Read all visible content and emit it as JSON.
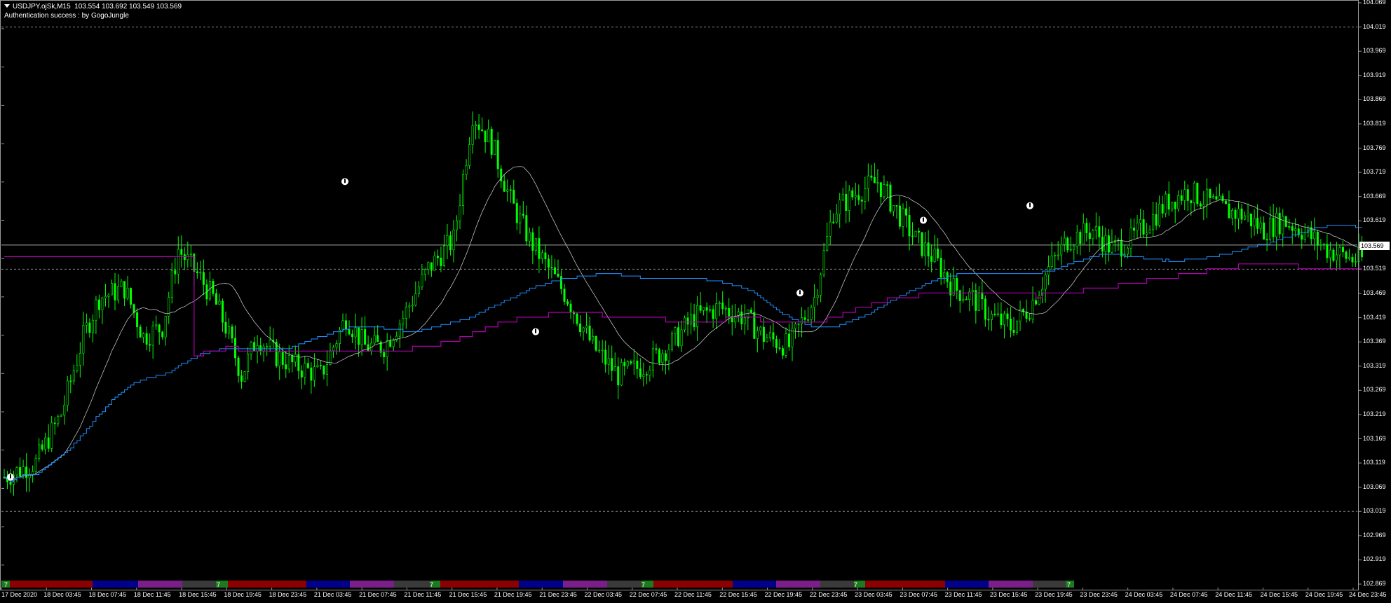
{
  "header": {
    "symbol_line": "USDJPY.ojSk,M15  103.554 103.692 103.549 103.569",
    "auth_line": "Authentication success : by GogoJungle"
  },
  "price_axis": {
    "ticks": [
      "104.069",
      "104.019",
      "103.969",
      "103.919",
      "103.869",
      "103.819",
      "103.769",
      "103.719",
      "103.669",
      "103.619",
      "103.569",
      "103.519",
      "103.469",
      "103.419",
      "103.369",
      "103.319",
      "103.269",
      "103.219",
      "103.169",
      "103.119",
      "103.069",
      "103.019",
      "102.969",
      "102.919",
      "102.869"
    ],
    "current_price": "103.569"
  },
  "time_axis": {
    "ticks": [
      "17 Dec 2020",
      "18 Dec 03:45",
      "18 Dec 07:45",
      "18 Dec 11:45",
      "18 Dec 15:45",
      "18 Dec 19:45",
      "18 Dec 23:45",
      "21 Dec 03:45",
      "21 Dec 07:45",
      "21 Dec 11:45",
      "21 Dec 15:45",
      "21 Dec 19:45",
      "21 Dec 23:45",
      "22 Dec 03:45",
      "22 Dec 07:45",
      "22 Dec 11:45",
      "22 Dec 15:45",
      "22 Dec 19:45",
      "22 Dec 23:45",
      "23 Dec 03:45",
      "23 Dec 07:45",
      "23 Dec 11:45",
      "23 Dec 15:45",
      "23 Dec 19:45",
      "23 Dec 23:45",
      "24 Dec 03:45",
      "24 Dec 07:45",
      "24 Dec 11:45",
      "24 Dec 15:45",
      "24 Dec 19:45",
      "24 Dec 23:45"
    ]
  },
  "session_bar": {
    "marker_text": "7",
    "colors": {
      "green": "#1e7a1e",
      "red": "#8b0000",
      "blue": "#00008b",
      "purple": "#7a1f8a",
      "gray": "#3a3a3a"
    }
  },
  "chart_data": {
    "type": "candlestick",
    "symbol": "USDJPY.ojSk",
    "timeframe": "M15",
    "ohlc_last": {
      "open": 103.554,
      "high": 103.692,
      "low": 103.549,
      "close": 103.569
    },
    "ylim": [
      102.869,
      104.069
    ],
    "grid": false,
    "candle_color": "#00ff00",
    "indicator_colors": {
      "fast_ma": "#c0c0c0",
      "slow_ma": "#1e90ff",
      "long_ma": "#b000b0"
    },
    "price_path": [
      [
        0,
        103.09
      ],
      [
        10,
        103.12
      ],
      [
        18,
        103.22
      ],
      [
        25,
        103.38
      ],
      [
        30,
        103.46
      ],
      [
        38,
        103.48
      ],
      [
        44,
        103.38
      ],
      [
        50,
        103.4
      ],
      [
        55,
        103.56
      ],
      [
        62,
        103.5
      ],
      [
        66,
        103.46
      ],
      [
        70,
        103.4
      ],
      [
        75,
        103.3
      ],
      [
        80,
        103.38
      ],
      [
        86,
        103.34
      ],
      [
        92,
        103.32
      ],
      [
        100,
        103.3
      ],
      [
        108,
        103.42
      ],
      [
        114,
        103.36
      ],
      [
        120,
        103.36
      ],
      [
        126,
        103.42
      ],
      [
        134,
        103.52
      ],
      [
        142,
        103.58
      ],
      [
        148,
        103.84
      ],
      [
        154,
        103.78
      ],
      [
        160,
        103.66
      ],
      [
        166,
        103.58
      ],
      [
        172,
        103.52
      ],
      [
        178,
        103.46
      ],
      [
        186,
        103.36
      ],
      [
        194,
        103.3
      ],
      [
        202,
        103.32
      ],
      [
        210,
        103.36
      ],
      [
        218,
        103.42
      ],
      [
        226,
        103.44
      ],
      [
        234,
        103.42
      ],
      [
        240,
        103.38
      ],
      [
        248,
        103.36
      ],
      [
        256,
        103.46
      ],
      [
        262,
        103.64
      ],
      [
        270,
        103.68
      ],
      [
        276,
        103.7
      ],
      [
        282,
        103.64
      ],
      [
        288,
        103.58
      ],
      [
        294,
        103.54
      ],
      [
        300,
        103.48
      ],
      [
        306,
        103.46
      ],
      [
        312,
        103.42
      ],
      [
        318,
        103.4
      ],
      [
        324,
        103.44
      ],
      [
        330,
        103.52
      ],
      [
        336,
        103.58
      ],
      [
        344,
        103.6
      ],
      [
        350,
        103.56
      ],
      [
        356,
        103.58
      ],
      [
        362,
        103.62
      ],
      [
        368,
        103.66
      ],
      [
        374,
        103.68
      ],
      [
        380,
        103.66
      ],
      [
        386,
        103.64
      ],
      [
        392,
        103.63
      ],
      [
        398,
        103.6
      ],
      [
        404,
        103.62
      ],
      [
        410,
        103.6
      ],
      [
        418,
        103.56
      ],
      [
        426,
        103.54
      ]
    ],
    "session_ranges": [
      [
        [
          0,
          12
        ],
        "green"
      ],
      [
        [
          12,
          130
        ],
        "red"
      ],
      [
        [
          130,
          195
        ],
        "blue"
      ],
      [
        [
          195,
          258
        ],
        "purple"
      ],
      [
        [
          258,
          306
        ],
        "gray"
      ],
      [
        [
          306,
          323
        ],
        "green"
      ],
      [
        [
          323,
          435
        ],
        "red"
      ],
      [
        [
          435,
          497
        ],
        "blue"
      ],
      [
        [
          497,
          560
        ],
        "purple"
      ],
      [
        [
          560,
          612
        ],
        "gray"
      ],
      [
        [
          612,
          626
        ],
        "green"
      ],
      [
        [
          626,
          738
        ],
        "red"
      ],
      [
        [
          738,
          801
        ],
        "blue"
      ],
      [
        [
          801,
          864
        ],
        "purple"
      ],
      [
        [
          864,
          913
        ],
        "gray"
      ],
      [
        [
          913,
          930
        ],
        "green"
      ],
      [
        [
          930,
          1043
        ],
        "red"
      ],
      [
        [
          1043,
          1105
        ],
        "blue"
      ],
      [
        [
          1105,
          1168
        ],
        "purple"
      ],
      [
        [
          1168,
          1216
        ],
        "gray"
      ],
      [
        [
          1216,
          1232
        ],
        "green"
      ],
      [
        [
          1232,
          1346
        ],
        "red"
      ],
      [
        [
          1346,
          1408
        ],
        "blue"
      ],
      [
        [
          1408,
          1471
        ],
        "purple"
      ],
      [
        [
          1471,
          1518
        ],
        "gray"
      ],
      [
        [
          1518,
          1530
        ],
        "green"
      ]
    ],
    "session_markers_at": [
      6,
      309,
      613,
      915,
      1218,
      1522
    ],
    "arrow_icons": [
      [
        15,
        103.09
      ],
      [
        492,
        103.7
      ],
      [
        764,
        103.39
      ],
      [
        1141,
        103.47
      ],
      [
        1317,
        103.62
      ],
      [
        1469,
        103.65
      ]
    ]
  }
}
